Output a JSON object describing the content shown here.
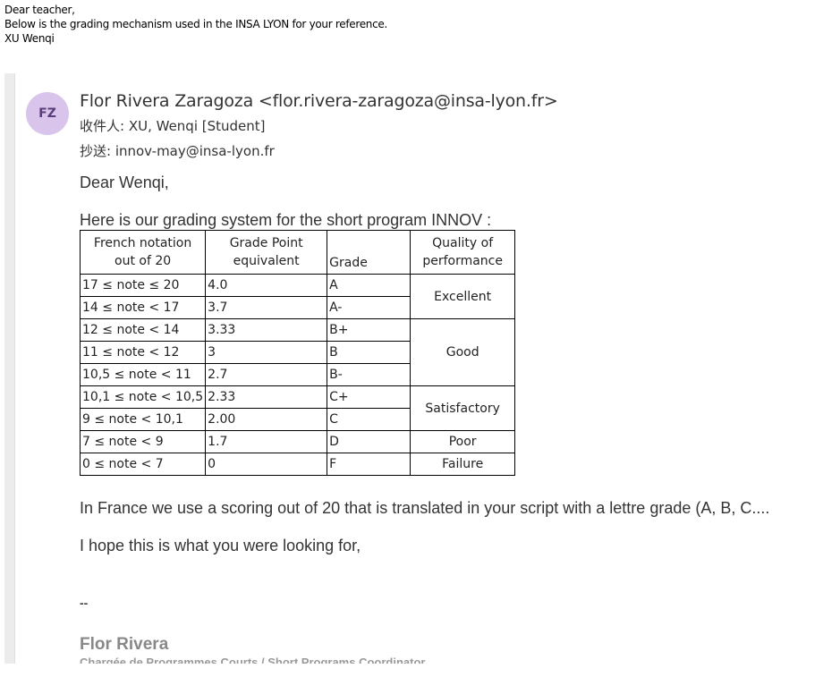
{
  "intro": {
    "line1": "Dear teacher,",
    "line2": "Below is the grading mechanism used in the INSA LYON for your reference.",
    "line3": "XU Wenqi"
  },
  "email": {
    "avatar_initials": "FZ",
    "avatar_color": "#d9c5eb",
    "from": "Flor Rivera Zaragoza <flor.rivera-zaragoza@insa-lyon.fr>",
    "to": "收件人: XU, Wenqi [Student]",
    "cc": "抄送: innov-may@insa-lyon.fr",
    "greeting": "Dear Wenqi,",
    "intro_line": "Here is our grading system for the short program INNOV :",
    "table": {
      "headers": [
        "French notation out of 20",
        "Grade Point equivalent",
        "Grade",
        "Quality of performance"
      ],
      "rows": [
        {
          "notation": "17 ≤ note ≤ 20",
          "gpa": "4.0",
          "grade": "A"
        },
        {
          "notation": "14 ≤ note < 17",
          "gpa": "3.7",
          "grade": "A-"
        },
        {
          "notation": "12 ≤ note < 14",
          "gpa": "3.33",
          "grade": "B+"
        },
        {
          "notation": "11 ≤ note < 12",
          "gpa": "3",
          "grade": "B"
        },
        {
          "notation": "10,5 ≤ note < 11",
          "gpa": "2.7",
          "grade": "B-"
        },
        {
          "notation": "10,1 ≤ note < 10,5",
          "gpa": "2.33",
          "grade": "C+"
        },
        {
          "notation": "9 ≤ note < 10,1",
          "gpa": "2.00",
          "grade": "C"
        },
        {
          "notation": "7 ≤ note < 9",
          "gpa": "1.7",
          "grade": "D"
        },
        {
          "notation": "0 ≤ note < 7",
          "gpa": "0",
          "grade": "F"
        }
      ],
      "quality": [
        "Excellent",
        "Good",
        "Satisfactory",
        "Poor",
        "Failure"
      ]
    },
    "para1": "In France we use a scoring out of 20 that is translated in your script with a lettre grade (A, B, C....",
    "para2": "I hope this is what you were looking for,",
    "separator": "--",
    "signature_name": "Flor Rivera",
    "signature_title": "Chargée de Programmes Courts / Short Programs Coordinator"
  }
}
